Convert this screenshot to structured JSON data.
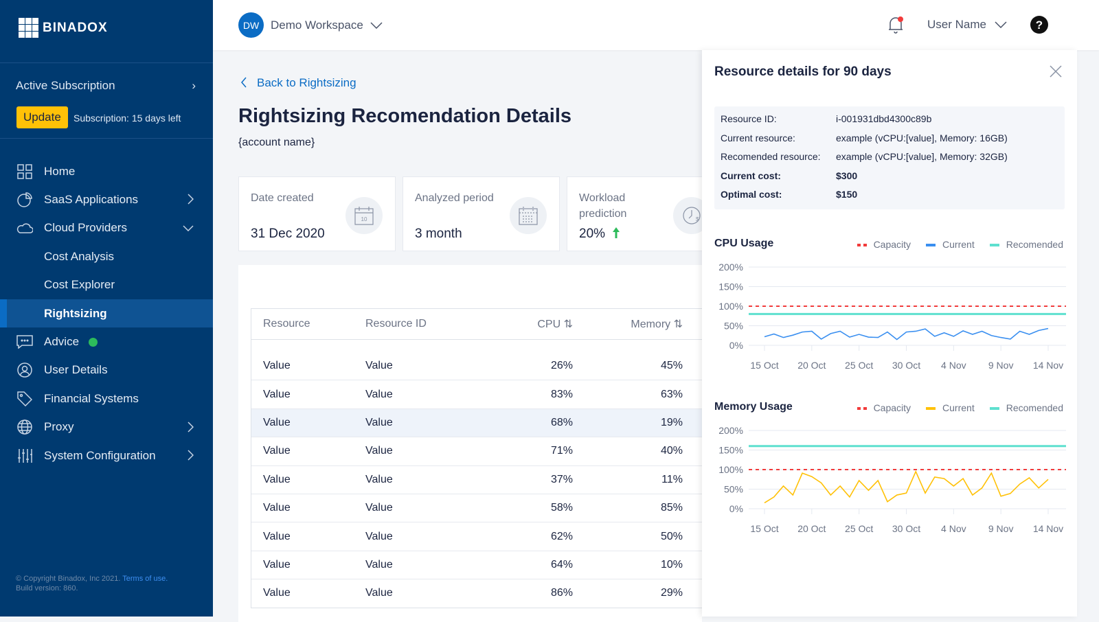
{
  "brand": "BINADOX",
  "sidebar": {
    "subscription_label": "Active Subscription",
    "update_label": "Update",
    "subscription_status": "Subscription: 15 days left",
    "items": [
      {
        "label": "Home",
        "icon": "grid-icon"
      },
      {
        "label": "SaaS Applications",
        "icon": "pie-chart-icon"
      },
      {
        "label": "Cloud Providers",
        "icon": "cloud-icon"
      },
      {
        "label": "Cost Analysis"
      },
      {
        "label": "Cost Explorer"
      },
      {
        "label": "Rightsizing",
        "active": true
      },
      {
        "label": "Advice",
        "icon": "chat-icon",
        "status_color": "#2dbb5b"
      },
      {
        "label": "User Details",
        "icon": "user-icon"
      },
      {
        "label": "Financial Systems",
        "icon": "tag-icon"
      },
      {
        "label": "Proxy",
        "icon": "globe-icon"
      },
      {
        "label": "System Configuration",
        "icon": "sliders-icon"
      }
    ],
    "copyright": "© Copyright Binadox, Inc 2021.",
    "terms": "Terms of use.",
    "build": "Build version: 860."
  },
  "header": {
    "workspace_initials": "DW",
    "workspace": "Demo Workspace",
    "user": "User Name"
  },
  "main": {
    "back": "Back to Rightsizing",
    "title": "Rightsizing Recomendation Details",
    "account": "{account name}",
    "cards": [
      {
        "label": "Date created",
        "value": "31 Dec 2020",
        "icon": "calendar-icon"
      },
      {
        "label": "Analyzed period",
        "value": "3 month",
        "icon": "calendar-grid-icon"
      },
      {
        "label": "Workload prediction",
        "value": "20%",
        "icon": "clock-dollar-icon",
        "trend": "up"
      }
    ],
    "table": {
      "columns": [
        "Resource",
        "Resource ID",
        "CPU",
        "Memory"
      ],
      "rows": [
        [
          "Value",
          "Value",
          "26%",
          "45%"
        ],
        [
          "Value",
          "Value",
          "83%",
          "63%"
        ],
        [
          "Value",
          "Value",
          "68%",
          "19%"
        ],
        [
          "Value",
          "Value",
          "71%",
          "40%"
        ],
        [
          "Value",
          "Value",
          "37%",
          "11%"
        ],
        [
          "Value",
          "Value",
          "58%",
          "85%"
        ],
        [
          "Value",
          "Value",
          "62%",
          "50%"
        ],
        [
          "Value",
          "Value",
          "64%",
          "10%"
        ],
        [
          "Value",
          "Value",
          "86%",
          "29%"
        ]
      ]
    }
  },
  "panel": {
    "title": "Resource details for 90 days",
    "info": [
      {
        "k": "Resource ID:",
        "v": "i-001931dbd4300c89b"
      },
      {
        "k": "Current resource:",
        "v": "example (vCPU:[value], Memory: 16GB)"
      },
      {
        "k": "Recomended resource:",
        "v": "example (vCPU:[value], Memory: 32GB)"
      },
      {
        "k": "Current cost:",
        "v": "$300",
        "bold": true
      },
      {
        "k": "Optimal cost:",
        "v": "$150",
        "bold": true
      }
    ]
  },
  "chart_data": [
    {
      "type": "line",
      "title": "CPU Usage",
      "ylim": [
        0,
        200
      ],
      "yticks": [
        "0%",
        "50%",
        "100%",
        "150%",
        "200%"
      ],
      "xticks": [
        "15 Oct",
        "20 Oct",
        "25 Oct",
        "30 Oct",
        "4 Nov",
        "9 Nov",
        "14 Nov"
      ],
      "grid": true,
      "legend": "top-right",
      "series": [
        {
          "name": "Capacity",
          "color": "#f23b3b",
          "dashed": true,
          "constant": 100
        },
        {
          "name": "Current",
          "color": "#3a8ff0",
          "values": [
            22,
            29,
            20,
            26,
            34,
            36,
            16,
            30,
            36,
            21,
            28,
            21,
            20,
            34,
            15,
            34,
            36,
            42,
            23,
            32,
            23,
            37,
            28,
            36,
            25,
            20,
            16,
            36,
            28,
            38,
            43
          ]
        },
        {
          "name": "Recomended",
          "color": "#5ee0cf",
          "constant": 80
        }
      ]
    },
    {
      "type": "line",
      "title": "Memory Usage",
      "ylim": [
        0,
        200
      ],
      "yticks": [
        "0%",
        "50%",
        "100%",
        "150%",
        "200%"
      ],
      "xticks": [
        "15 Oct",
        "20 Oct",
        "25 Oct",
        "30 Oct",
        "4 Nov",
        "9 Nov",
        "14 Nov"
      ],
      "grid": true,
      "legend": "top-right",
      "series": [
        {
          "name": "Capacity",
          "color": "#f23b3b",
          "dashed": true,
          "constant": 100
        },
        {
          "name": "Current",
          "color": "#ffc107",
          "values": [
            15,
            30,
            58,
            35,
            91,
            82,
            66,
            35,
            58,
            30,
            72,
            47,
            72,
            18,
            35,
            40,
            95,
            40,
            81,
            77,
            58,
            77,
            35,
            53,
            91,
            32,
            39,
            63,
            79,
            53,
            75
          ]
        },
        {
          "name": "Recomended",
          "color": "#5ee0cf",
          "constant": 160
        }
      ]
    }
  ]
}
